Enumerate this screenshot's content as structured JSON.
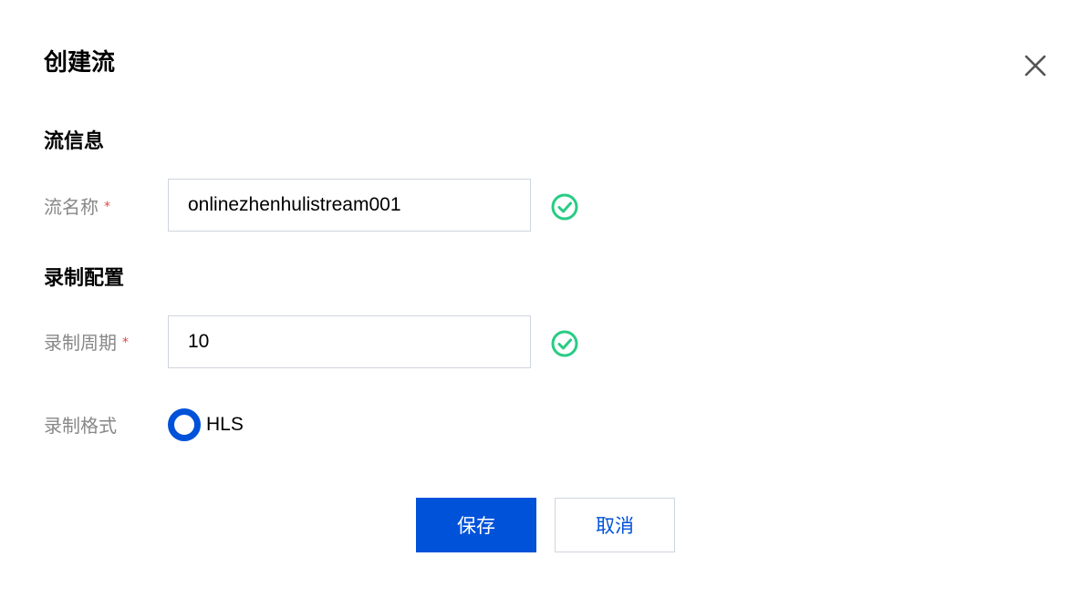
{
  "dialog": {
    "title": "创建流",
    "close_icon": "close-icon"
  },
  "sections": {
    "stream_info": "流信息",
    "record_config": "录制配置"
  },
  "fields": {
    "stream_name": {
      "label": "流名称",
      "required_mark": "*",
      "value": "onlinezhenhulistream001",
      "status_icon": "check-circle-icon"
    },
    "record_period": {
      "label": "录制周期",
      "required_mark": "*",
      "value": "10",
      "status_icon": "check-circle-icon"
    },
    "record_format": {
      "label": "录制格式",
      "option": "HLS",
      "selected": true
    }
  },
  "buttons": {
    "save": "保存",
    "cancel": "取消"
  },
  "colors": {
    "primary": "#0052d9",
    "success": "#29cc85",
    "required": "#e54545",
    "label": "#888888",
    "border": "#cfd5de"
  }
}
